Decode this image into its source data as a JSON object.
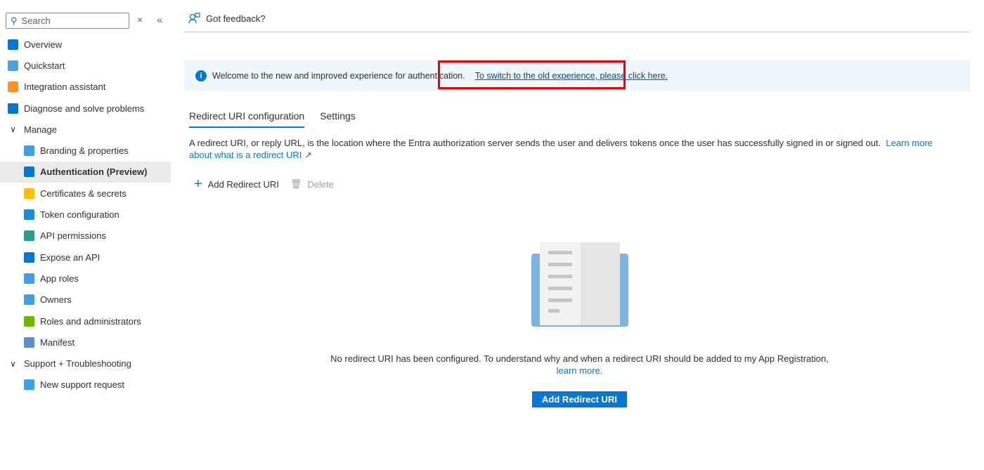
{
  "sidebar": {
    "search_placeholder": "Search",
    "items": [
      {
        "label": "Overview",
        "color": "#0078d4"
      },
      {
        "label": "Quickstart",
        "color": "#50a0e0"
      },
      {
        "label": "Integration assistant",
        "color": "#f7931e"
      },
      {
        "label": "Diagnose and solve problems",
        "color": "#0078d4"
      },
      {
        "label": "Manage"
      },
      {
        "label": "Branding & properties",
        "color": "#3f9ee8"
      },
      {
        "label": "Authentication (Preview)",
        "color": "#0078d4"
      },
      {
        "label": "Certificates & secrets",
        "color": "#f7c000"
      },
      {
        "label": "Token configuration",
        "color": "#1f8ad6"
      },
      {
        "label": "API permissions",
        "color": "#2a9d8f"
      },
      {
        "label": "Expose an API",
        "color": "#0078d4"
      },
      {
        "label": "App roles",
        "color": "#3f9ee8"
      },
      {
        "label": "Owners",
        "color": "#3f9ee8"
      },
      {
        "label": "Roles and administrators",
        "color": "#6bb700"
      },
      {
        "label": "Manifest",
        "color": "#5b8fc7"
      },
      {
        "label": "Support + Troubleshooting"
      },
      {
        "label": "New support request",
        "color": "#3f9ee8"
      }
    ]
  },
  "header": {
    "feedback": "Got feedback?"
  },
  "banner": {
    "text": "Welcome to the new and improved experience for authentication.",
    "link": "To switch to the old experience, please click here."
  },
  "tabs": [
    "Redirect URI configuration",
    "Settings"
  ],
  "description": {
    "text": "A redirect URI, or reply URL, is the location where the Entra authorization server sends the user and delivers tokens once the user has successfully signed in or signed out.",
    "link": "Learn more about what is a redirect URI"
  },
  "toolbar": {
    "add": "Add Redirect URI",
    "delete": "Delete"
  },
  "empty": {
    "text": "No redirect URI has been configured. To understand why and when a redirect URI should be added to my App Registration,",
    "link": "learn more.",
    "button": "Add Redirect URI"
  }
}
